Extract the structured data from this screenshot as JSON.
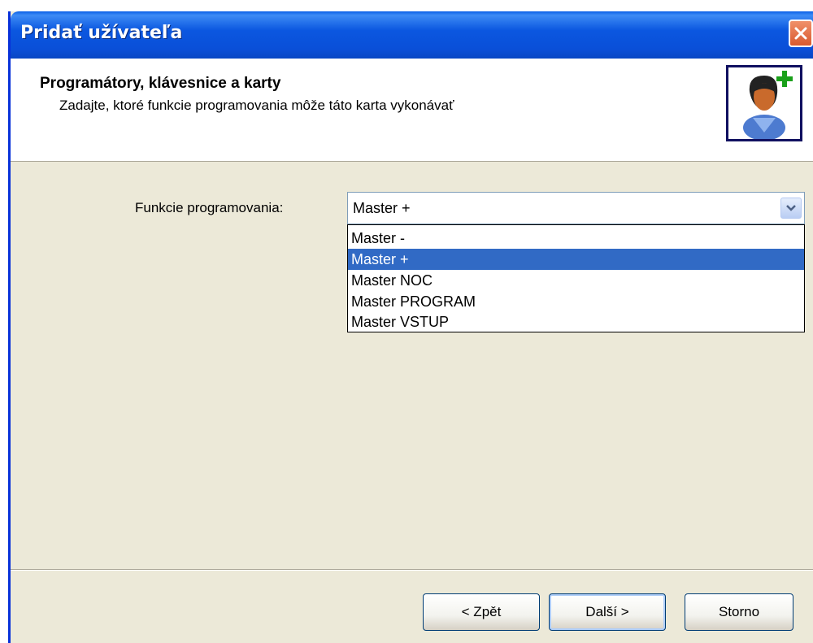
{
  "window": {
    "title": "Pridať užívateľa"
  },
  "header": {
    "title": "Programátory, klávesnice a karty",
    "subtitle": "Zadajte, ktoré funkcie programovania môže táto karta vykonávať"
  },
  "form": {
    "label": "Funkcie programovania:",
    "selected": "Master +",
    "options": [
      "Master -",
      "Master +",
      "Master NOC",
      "Master PROGRAM",
      "Master VSTUP"
    ],
    "selected_index": 1
  },
  "buttons": {
    "back": "< Zpět",
    "next": "Další >",
    "cancel": "Storno"
  },
  "colors": {
    "titlebar": "#0a4fd8",
    "selection": "#316ac5",
    "dialog_bg": "#ece9d8"
  },
  "icons": {
    "close": "close-icon",
    "user": "add-user-icon",
    "arrow": "chevron-down-icon"
  }
}
